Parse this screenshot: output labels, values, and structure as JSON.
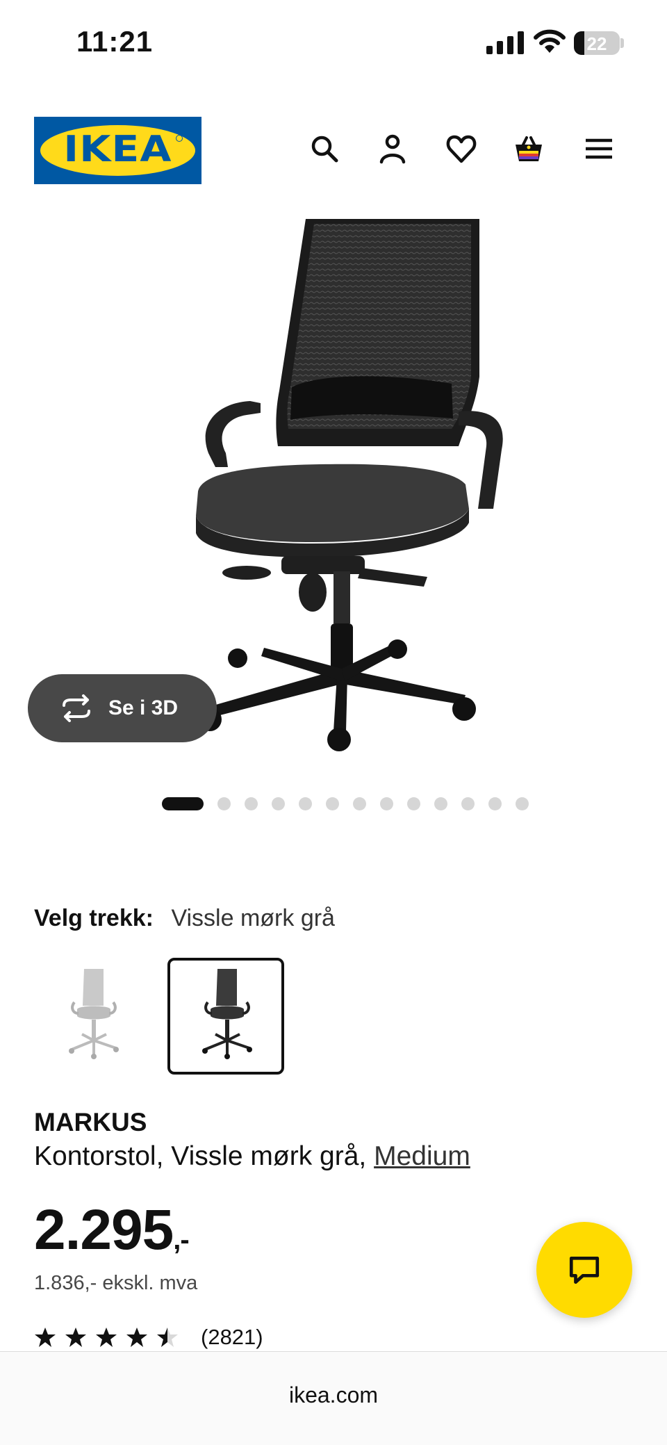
{
  "status_bar": {
    "time": "11:21",
    "battery_level": "22",
    "battery_fraction": 0.22
  },
  "header": {
    "logo_text": "IKEA",
    "icons": [
      "search-icon",
      "account-icon",
      "heart-icon",
      "cart-icon",
      "menu-icon"
    ]
  },
  "gallery": {
    "view_3d_label": "Se i 3D",
    "image_count": 13,
    "active_index": 0
  },
  "variant": {
    "label": "Velg trekk:",
    "selected_value": "Vissle mørk grå",
    "options": [
      "light-grey-chair-thumbnail",
      "dark-grey-chair-thumbnail"
    ],
    "selected_index": 1
  },
  "product": {
    "name": "MARKUS",
    "description": "Kontorstol, Vissle mørk grå,",
    "size_link": "Medium",
    "price_main": "2.295",
    "price_suffix": ",-",
    "price_ex_vat": "1.836,- ekskl. mva",
    "rating_value": 4.5,
    "rating_count": "(2821)"
  },
  "browser": {
    "url": "ikea.com"
  },
  "colors": {
    "brand_blue": "#0058a3",
    "brand_yellow": "#ffda1a",
    "chat_yellow": "#ffdb00"
  }
}
